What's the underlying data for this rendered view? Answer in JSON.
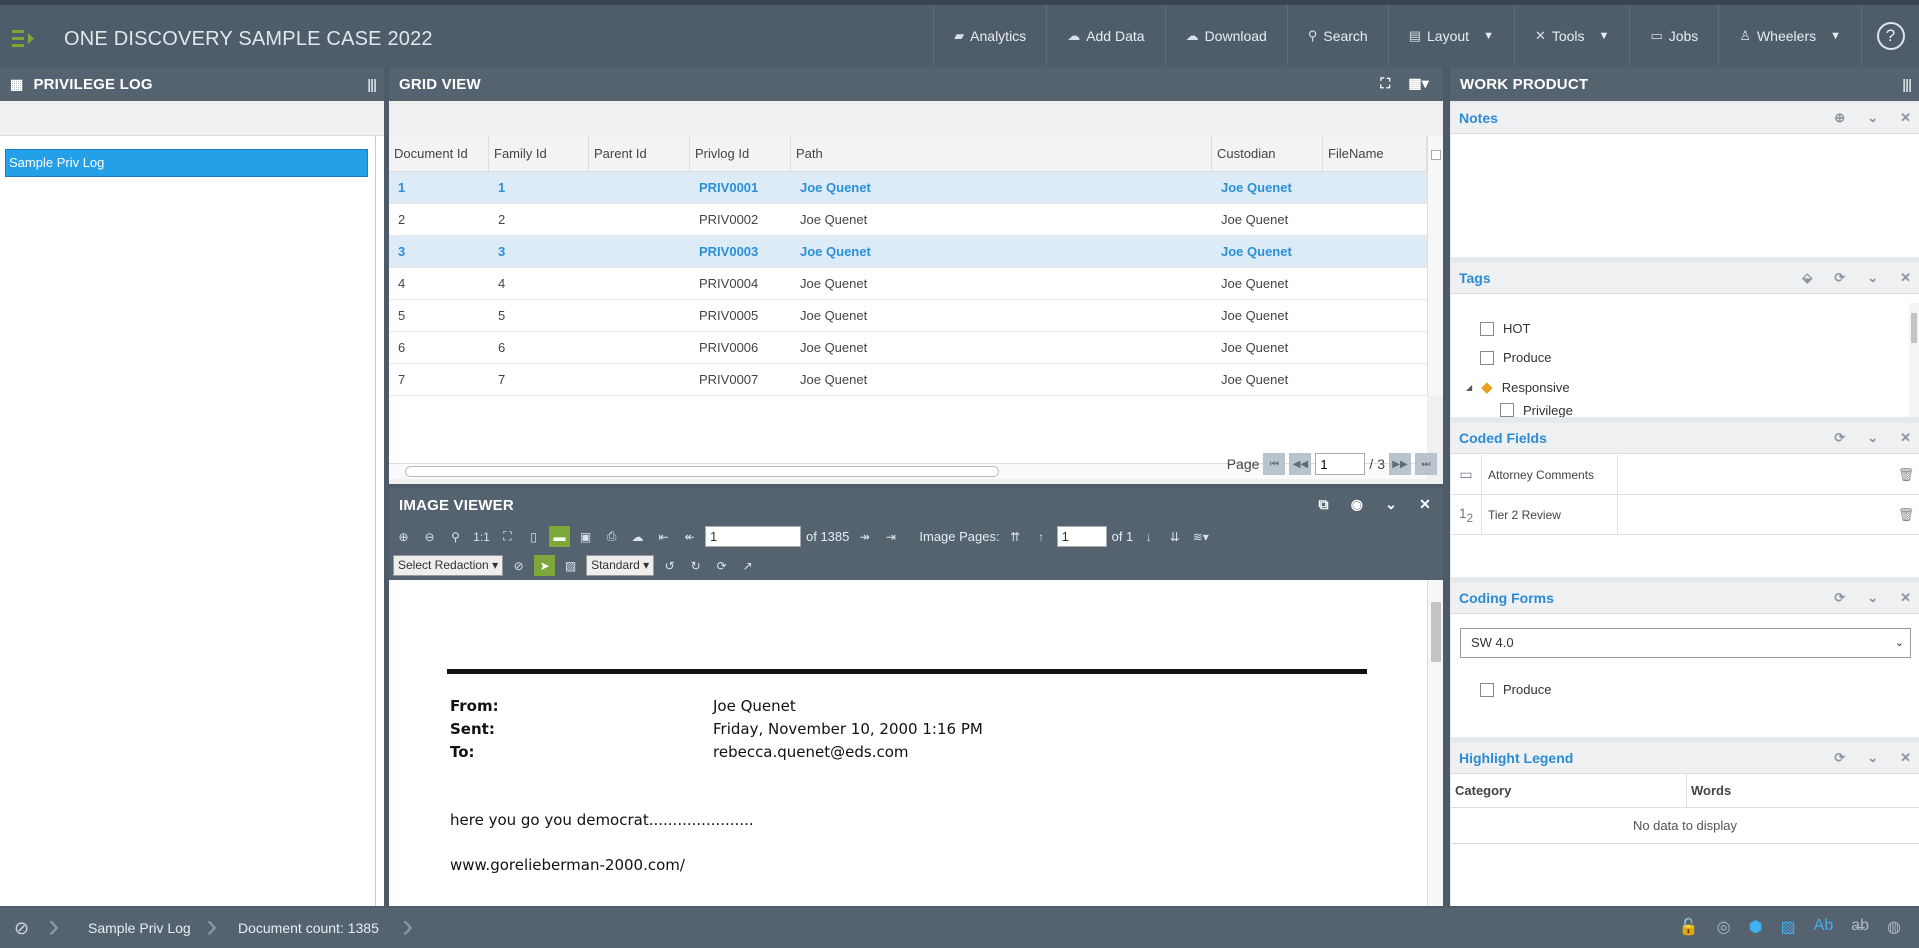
{
  "app": {
    "title": "ONE DISCOVERY SAMPLE CASE 2022"
  },
  "nav": [
    {
      "label": "Analytics",
      "icon": "briefcase-icon"
    },
    {
      "label": "Add Data",
      "icon": "cloud-upload-icon"
    },
    {
      "label": "Download",
      "icon": "cloud-download-icon"
    },
    {
      "label": "Search",
      "icon": "search-icon"
    },
    {
      "label": "Layout",
      "icon": "layout-icon"
    },
    {
      "label": "Tools",
      "icon": "tools-icon"
    },
    {
      "label": "Jobs",
      "icon": "jobs-icon"
    },
    {
      "label": "Wheelers",
      "icon": "user-icon"
    }
  ],
  "privlog": {
    "title": "PRIVILEGE LOG",
    "selected": "Sample Priv Log"
  },
  "grid": {
    "title": "GRID VIEW",
    "columns": [
      "Document Id",
      "Family Id",
      "Parent Id",
      "Privlog Id",
      "Path",
      "Custodian",
      "FileName"
    ],
    "rows": [
      {
        "doc": "1",
        "fam": "1",
        "parent": "",
        "priv": "PRIV0001",
        "path": "Joe Quenet",
        "cust": "Joe Quenet",
        "file": "",
        "hl": true
      },
      {
        "doc": "2",
        "fam": "2",
        "parent": "",
        "priv": "PRIV0002",
        "path": "Joe Quenet",
        "cust": "Joe Quenet",
        "file": "",
        "hl": false
      },
      {
        "doc": "3",
        "fam": "3",
        "parent": "",
        "priv": "PRIV0003",
        "path": "Joe Quenet",
        "cust": "Joe Quenet",
        "file": "",
        "hl": true
      },
      {
        "doc": "4",
        "fam": "4",
        "parent": "",
        "priv": "PRIV0004",
        "path": "Joe Quenet",
        "cust": "Joe Quenet",
        "file": "",
        "hl": false
      },
      {
        "doc": "5",
        "fam": "5",
        "parent": "",
        "priv": "PRIV0005",
        "path": "Joe Quenet",
        "cust": "Joe Quenet",
        "file": "",
        "hl": false
      },
      {
        "doc": "6",
        "fam": "6",
        "parent": "",
        "priv": "PRIV0006",
        "path": "Joe Quenet",
        "cust": "Joe Quenet",
        "file": "",
        "hl": false
      },
      {
        "doc": "7",
        "fam": "7",
        "parent": "",
        "priv": "PRIV0007",
        "path": "Joe Quenet",
        "cust": "Joe Quenet",
        "file": "",
        "hl": false
      }
    ],
    "pager": {
      "label": "Page",
      "current": "1",
      "total": "/ 3"
    }
  },
  "viewer": {
    "title": "IMAGE VIEWER",
    "doc_number": "1",
    "doc_total": "of 1385",
    "image_pages_label": "Image Pages:",
    "image_page": "1",
    "image_total": "of 1",
    "redaction_select": "Select Redaction",
    "standard_select": "Standard",
    "email": {
      "from_label": "From:",
      "from": "Joe Quenet",
      "sent_label": "Sent:",
      "sent": "Friday, November 10, 2000 1:16 PM",
      "to_label": "To:",
      "to": "rebecca.quenet@eds.com",
      "body1": "here you go you democrat......................",
      "body2": "www.gorelieberman-2000.com/"
    }
  },
  "work": {
    "title": "WORK PRODUCT",
    "notes_title": "Notes",
    "tags_title": "Tags",
    "tags": [
      "HOT",
      "Produce",
      "Responsive",
      "Privilege"
    ],
    "coded_title": "Coded Fields",
    "coded": [
      "Attorney Comments",
      "Tier 2 Review"
    ],
    "coding_title": "Coding Forms",
    "coding_select": "SW 4.0",
    "coding_checkbox": "Produce",
    "legend_title": "Highlight Legend",
    "legend_cols": [
      "Category",
      "Words"
    ],
    "legend_empty": "No data to display"
  },
  "status": {
    "crumb1": "Sample Priv Log",
    "crumb2": "Document count: 1385"
  },
  "colors": {
    "accent": "#2c8bd6",
    "header": "#55626f",
    "selected": "#24a0e8",
    "active_tool": "#7ea73a"
  }
}
